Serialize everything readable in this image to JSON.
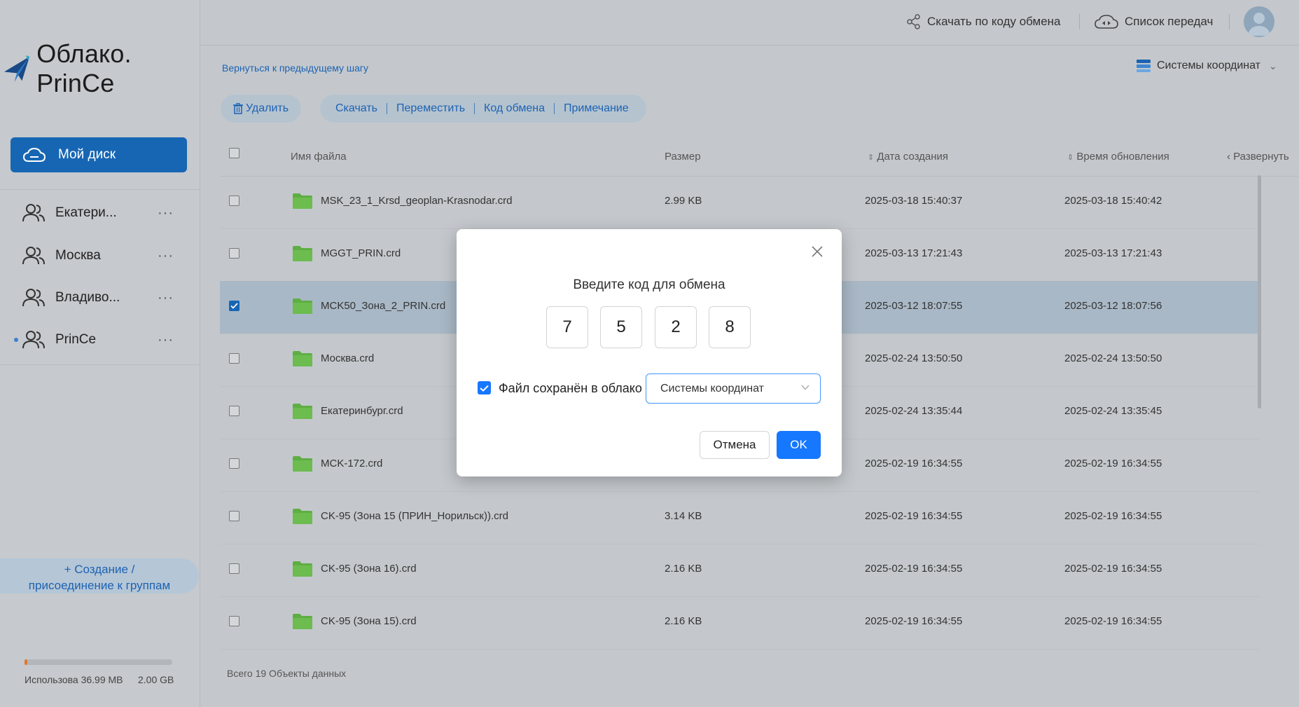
{
  "app": {
    "title": "Облако. PrinCe"
  },
  "sidebar": {
    "my_disk": "Мой диск",
    "groups": [
      {
        "label": "Екатери...",
        "more": "···"
      },
      {
        "label": "Москва",
        "more": "···"
      },
      {
        "label": "Владиво...",
        "more": "···"
      },
      {
        "label": "PrinCe",
        "more": "···",
        "active_dot": true
      }
    ],
    "create_group_line1": "+ Создание /",
    "create_group_line2": "присоединение к группам",
    "storage": {
      "used_label": "Использова 36.99 MB",
      "total": "2.00 GB",
      "used_fraction": 0.018
    }
  },
  "header": {
    "download_by_code": "Скачать по коду обмена",
    "transfers": "Список передач"
  },
  "toolbar": {
    "back": "Вернуться к предыдущему шагу",
    "coord_systems": "Системы координат",
    "delete": "Удалить",
    "download": "Скачать",
    "move": "Переместить",
    "exchange_code": "Код обмена",
    "note": "Примечание"
  },
  "table": {
    "columns": {
      "name": "Имя файла",
      "size": "Размер",
      "created": "Дата создания",
      "updated": "Время обновления",
      "expand": "Развернуть"
    },
    "rows": [
      {
        "name": "MSK_23_1_Krsd_geoplan-Krasnodar.crd",
        "size": "2.99 KB",
        "created": "2025-03-18 15:40:37",
        "updated": "2025-03-18 15:40:42",
        "checked": false
      },
      {
        "name": "MGGT_PRIN.crd",
        "size": "",
        "created": "2025-03-13 17:21:43",
        "updated": "2025-03-13 17:21:43",
        "checked": false
      },
      {
        "name": "MCK50_Зона_2_PRIN.crd",
        "size": "",
        "created": "2025-03-12 18:07:55",
        "updated": "2025-03-12 18:07:56",
        "checked": true
      },
      {
        "name": "Москва.crd",
        "size": "",
        "created": "2025-02-24 13:50:50",
        "updated": "2025-02-24 13:50:50",
        "checked": false
      },
      {
        "name": "Екатеринбург.crd",
        "size": "",
        "created": "2025-02-24 13:35:44",
        "updated": "2025-02-24 13:35:45",
        "checked": false
      },
      {
        "name": "MCK-172.crd",
        "size": "",
        "created": "2025-02-19 16:34:55",
        "updated": "2025-02-19 16:34:55",
        "checked": false
      },
      {
        "name": "CK-95 (Зона 15 (ПРИН_Норильск)).crd",
        "size": "3.14 KB",
        "created": "2025-02-19 16:34:55",
        "updated": "2025-02-19 16:34:55",
        "checked": false
      },
      {
        "name": "CK-95 (Зона 16).crd",
        "size": "2.16 KB",
        "created": "2025-02-19 16:34:55",
        "updated": "2025-02-19 16:34:55",
        "checked": false
      },
      {
        "name": "CK-95 (Зона 15).crd",
        "size": "2.16 KB",
        "created": "2025-02-19 16:34:55",
        "updated": "2025-02-19 16:34:55",
        "checked": false
      }
    ],
    "total": "Всего 19 Объекты данных"
  },
  "modal": {
    "title": "Введите код для обмена",
    "code": [
      "7",
      "5",
      "2",
      "8"
    ],
    "save_to_cloud_label": "Файл сохранён в облако",
    "save_to_cloud_checked": true,
    "folder_select": "Системы координат",
    "cancel": "Отмена",
    "ok": "OK"
  },
  "colors": {
    "accent": "#1677ff",
    "sidebar_active": "#1766b4",
    "folder": "#5fae45"
  }
}
